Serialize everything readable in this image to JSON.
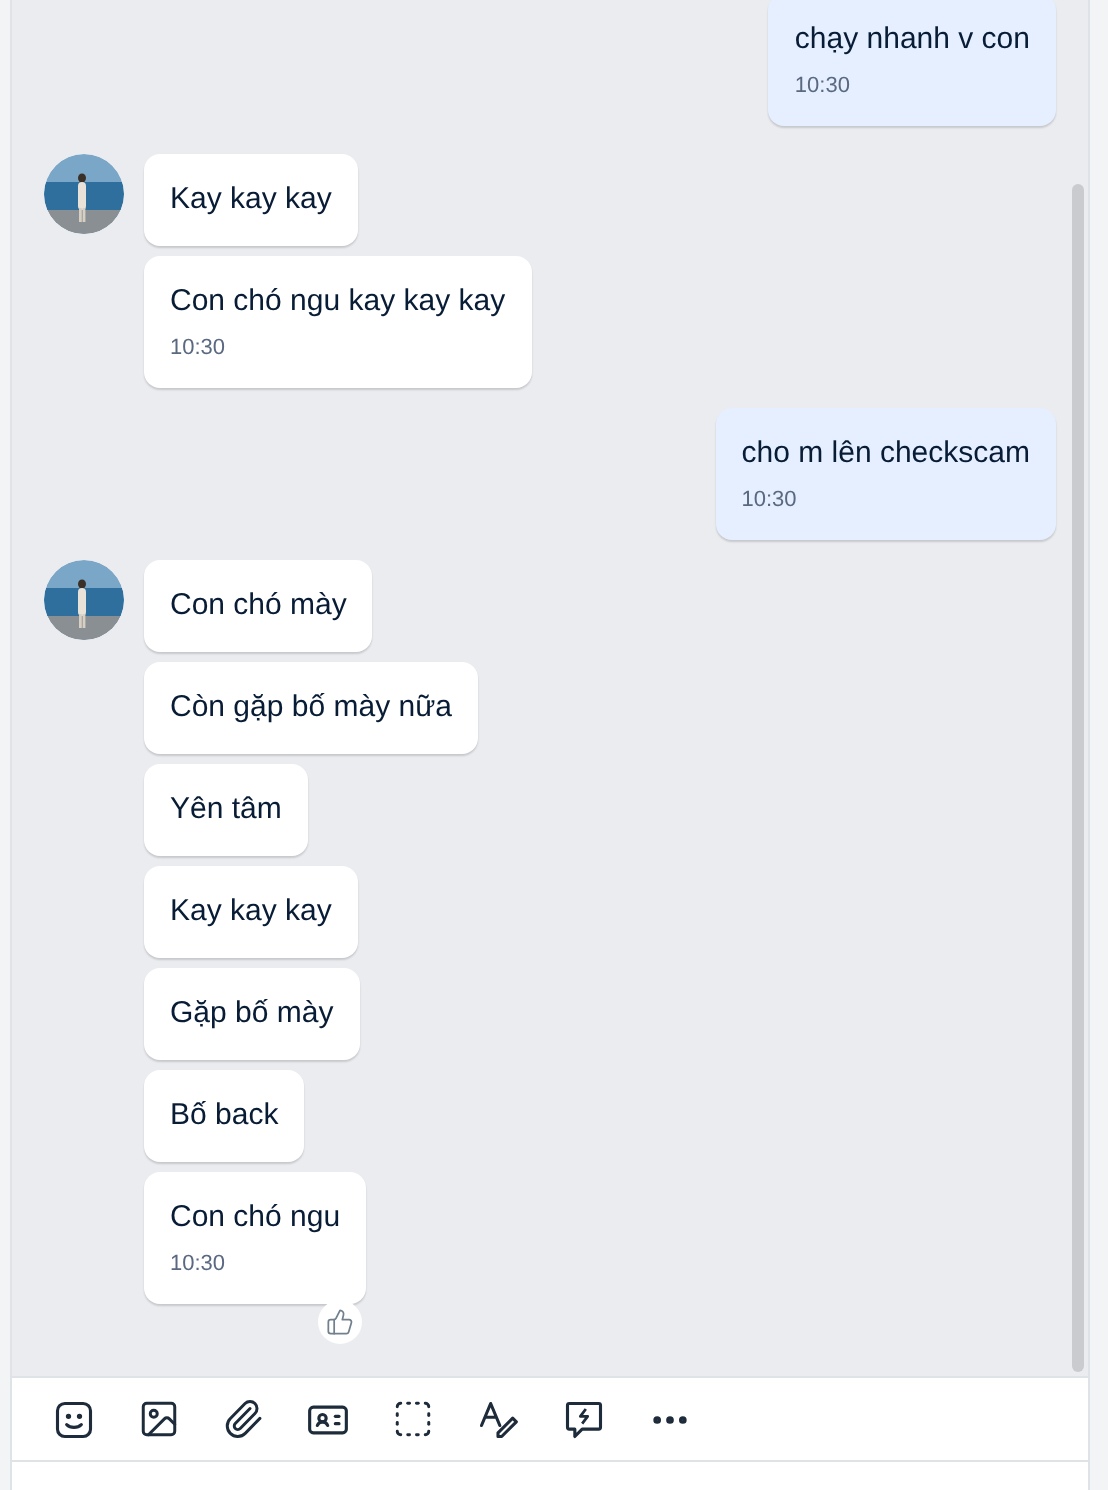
{
  "groups": [
    {
      "kind": "outgoing",
      "messages": [
        {
          "text": "chạy nhanh v con",
          "time": "10:30",
          "reaction": false
        }
      ]
    },
    {
      "kind": "incoming",
      "messages": [
        {
          "text": "Kay kay kay",
          "reaction": false
        },
        {
          "text": "Con chó ngu kay kay kay",
          "time": "10:30",
          "reaction": false
        }
      ]
    },
    {
      "kind": "outgoing",
      "messages": [
        {
          "text": "cho m lên checkscam",
          "time": "10:30",
          "reaction": false
        }
      ]
    },
    {
      "kind": "incoming",
      "messages": [
        {
          "text": "Con chó mày",
          "reaction": false
        },
        {
          "text": "Còn gặp bố mày nữa",
          "reaction": false
        },
        {
          "text": "Yên tâm",
          "reaction": false
        },
        {
          "text": "Kay kay kay",
          "reaction": false
        },
        {
          "text": "Gặp bố mày",
          "reaction": false
        },
        {
          "text": "Bố back",
          "reaction": false
        },
        {
          "text": "Con chó ngu",
          "time": "10:30",
          "reaction": true
        }
      ]
    }
  ]
}
